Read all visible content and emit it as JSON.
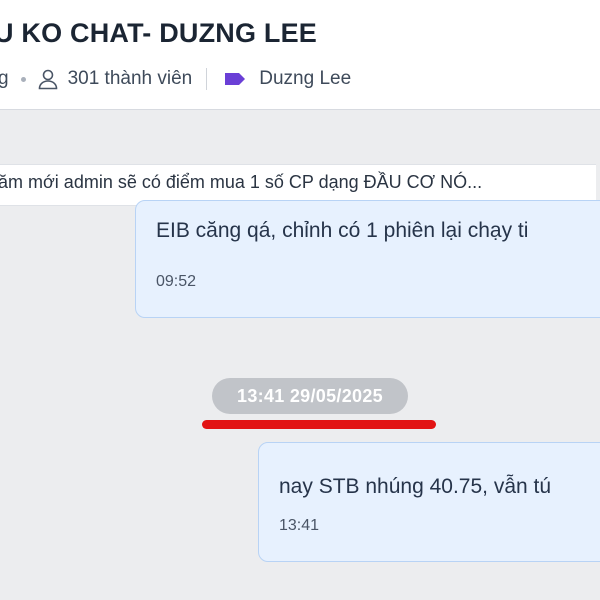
{
  "header": {
    "title": "U KO CHAT- DUZNG LEE",
    "meta_prefix": "g",
    "members": "301 thành viên",
    "owner": "Duzng Lee",
    "tag_color": "#6a3fd6"
  },
  "pinned": {
    "text": "ăm mới admin sẽ có điểm mua 1 số CP dạng ĐẦU CƠ NÓ..."
  },
  "messages": [
    {
      "text": "EIB căng qá, chỉnh có 1 phiên lại chạy ti",
      "time": "09:52"
    },
    {
      "text": "nay STB nhúng 40.75, vẫn tú",
      "time": "13:41"
    }
  ],
  "date_separator": "13:41 29/05/2025",
  "annotation": {
    "underline_color": "#e21414"
  }
}
